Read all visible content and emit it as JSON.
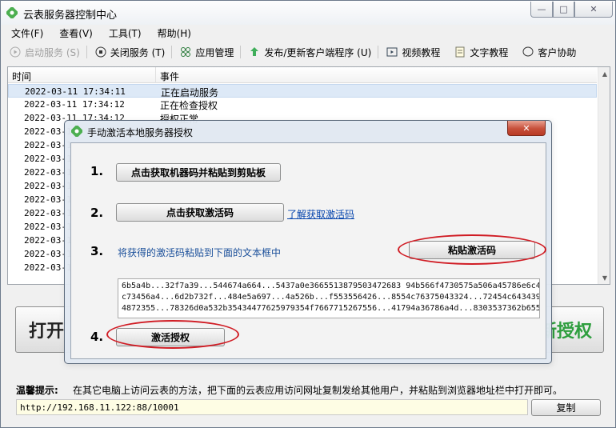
{
  "window": {
    "title": "云表服务器控制中心",
    "controls": {
      "minimize": "—",
      "maximize": "□",
      "close": "✕"
    }
  },
  "menu": [
    "文件(F)",
    "查看(V)",
    "工具(T)",
    "帮助(H)"
  ],
  "toolbar": {
    "start_service": "启动服务 (S)",
    "stop_service": "关闭服务 (T)",
    "app_manage": "应用管理",
    "publish_client": "发布/更新客户端程序 (U)",
    "video_tutorial": "视频教程",
    "text_tutorial": "文字教程",
    "customer_help": "客户协助"
  },
  "log": {
    "columns": {
      "time": "时间",
      "event": "事件"
    },
    "rows": [
      {
        "time": "2022-03-11 17:34:11",
        "event": "正在启动服务"
      },
      {
        "time": "2022-03-11 17:34:12",
        "event": "正在检查授权"
      },
      {
        "time": "2022-03-11 17:34:12",
        "event": "授权正常"
      },
      {
        "time": "2022-03-1",
        "event": ""
      },
      {
        "time": "2022-03-1",
        "event": ""
      },
      {
        "time": "2022-03-1",
        "event": ""
      },
      {
        "time": "2022-03-1",
        "event": ""
      },
      {
        "time": "2022-03-1",
        "event": ""
      },
      {
        "time": "2022-03-1",
        "event": ""
      },
      {
        "time": "2022-03-1",
        "event": ""
      },
      {
        "time": "2022-03-1",
        "event": ""
      },
      {
        "time": "2022-03-1",
        "event": ""
      },
      {
        "time": "2022-03-1",
        "event": ""
      },
      {
        "time": "2022-03-1",
        "event": ""
      }
    ]
  },
  "big_buttons": {
    "left": "打开",
    "right": "新授权"
  },
  "tips": {
    "label": "温馨提示:",
    "text": "在其它电脑上访问云表的方法，把下面的云表应用访问网址复制发给其他用户，并粘贴到浏览器地址栏中打开即可。",
    "url": "http://192.168.11.122:88/10001",
    "copy_button": "复制"
  },
  "dialog": {
    "title": "手动激活本地服务器授权",
    "close": "✕",
    "step1": {
      "num": "1.",
      "button": "点击获取机器码并粘贴到剪贴板"
    },
    "step2": {
      "num": "2.",
      "button": "点击获取激活码",
      "link": "了解获取激活码"
    },
    "step3": {
      "num": "3.",
      "instruction": "将获得的激活码粘贴到下面的文本框中",
      "paste_button": "粘贴激活码",
      "code_lines": [
        "6b5a4b...32f7a39...544674a664...5437a0e3665513879503472683 94b566f4730575a506a45786e6c496",
        "c73456a4...6d2b732f...484e5a697...4a526b...f553556426...8554c76375043324...72454c64343973",
        "4872355...78326d0a532b35434477625979354f7667715267556...41794a36786a4d...8303537362b6559"
      ]
    },
    "step4": {
      "num": "4.",
      "button": "激活授权"
    }
  },
  "colors": {
    "highlight_ring": "#d01c24",
    "link": "#0645ad",
    "instruction": "#1a4f9a",
    "green_text": "#2e9e3e"
  }
}
